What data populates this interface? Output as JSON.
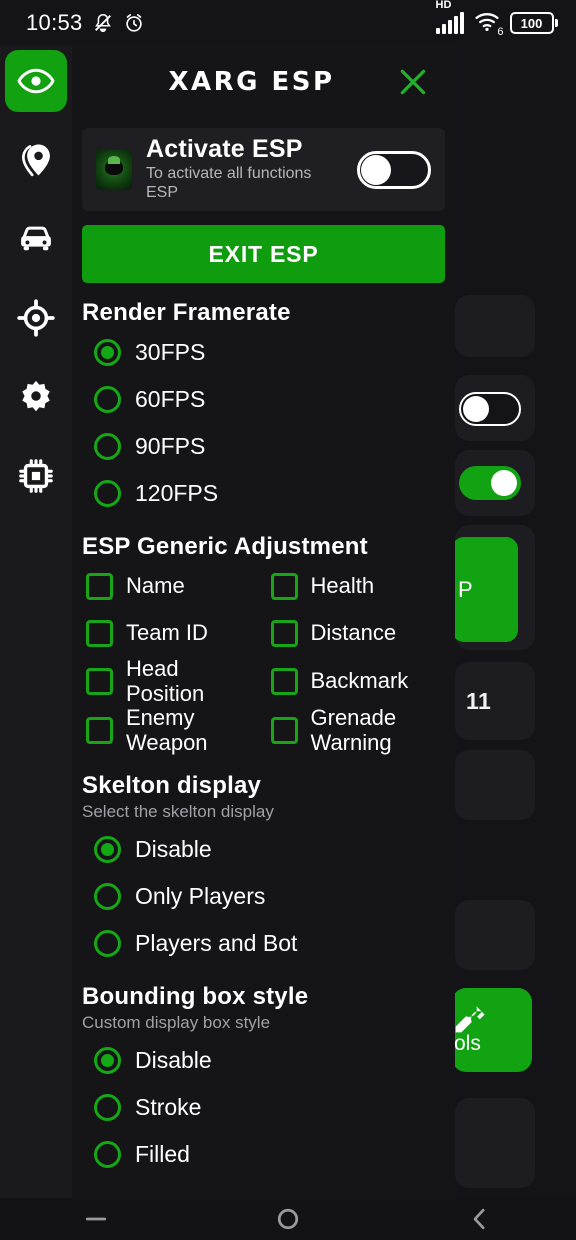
{
  "status_bar": {
    "clock": "10:53",
    "icons": [
      "mute-icon",
      "alarm-icon"
    ],
    "network_label": "HD",
    "wifi_label": "6",
    "battery_level": "100"
  },
  "header": {
    "title": "XARG ESP",
    "close_label": "✕"
  },
  "sidebar": {
    "items": [
      {
        "name": "eye-icon",
        "label": "ESP",
        "active": true
      },
      {
        "name": "location-pin-icon",
        "label": "Location",
        "active": false
      },
      {
        "name": "car-icon",
        "label": "Vehicle",
        "active": false
      },
      {
        "name": "crosshair-icon",
        "label": "Aim",
        "active": false
      },
      {
        "name": "gear-icon",
        "label": "Settings",
        "active": false
      },
      {
        "name": "chip-icon",
        "label": "Memory",
        "active": false
      }
    ]
  },
  "activate_card": {
    "title": "Activate ESP",
    "subtitle": "To activate all functions ESP",
    "toggle_state": "off"
  },
  "exit_button": {
    "label": "EXIT ESP"
  },
  "render_framerate": {
    "title": "Render Framerate",
    "options": [
      {
        "label": "30FPS",
        "selected": true
      },
      {
        "label": "60FPS",
        "selected": false
      },
      {
        "label": "90FPS",
        "selected": false
      },
      {
        "label": "120FPS",
        "selected": false
      }
    ]
  },
  "esp_generic_adjustment": {
    "title": "ESP Generic Adjustment",
    "items": [
      {
        "label": "Name",
        "checked": false
      },
      {
        "label": "Health",
        "checked": false
      },
      {
        "label": "Team ID",
        "checked": false
      },
      {
        "label": "Distance",
        "checked": false
      },
      {
        "label": "Head Position",
        "checked": false
      },
      {
        "label": "Backmark",
        "checked": false
      },
      {
        "label": "Enemy Weapon",
        "checked": false
      },
      {
        "label": "Grenade Warning",
        "checked": false
      }
    ]
  },
  "skelton_display": {
    "title": "Skelton display",
    "subtitle": "Select the skelton display",
    "options": [
      {
        "label": "Disable",
        "selected": true
      },
      {
        "label": "Only Players",
        "selected": false
      },
      {
        "label": "Players and Bot",
        "selected": false
      }
    ]
  },
  "bounding_box_style": {
    "title": "Bounding box style",
    "subtitle": "Custom display box style",
    "options": [
      {
        "label": "Disable",
        "selected": true
      },
      {
        "label": "Stroke",
        "selected": false
      },
      {
        "label": "Filled",
        "selected": false
      }
    ]
  },
  "background_app": {
    "partial_button_label": "P",
    "partial_text": "11",
    "partial_tools_label": "ols",
    "toggle_off_state": "off",
    "toggle_on_state": "on"
  },
  "nav_bar": {
    "items": [
      "recents-icon",
      "home-icon",
      "back-icon"
    ]
  },
  "colors": {
    "accent_green": "#0f9d0f",
    "radio_green": "#15a815",
    "panel_bg": "#151518",
    "card_bg": "#1f1f23",
    "sidebar_bg": "#1a1a1d",
    "text_primary": "#ffffff",
    "text_secondary": "#a0a0a6"
  }
}
